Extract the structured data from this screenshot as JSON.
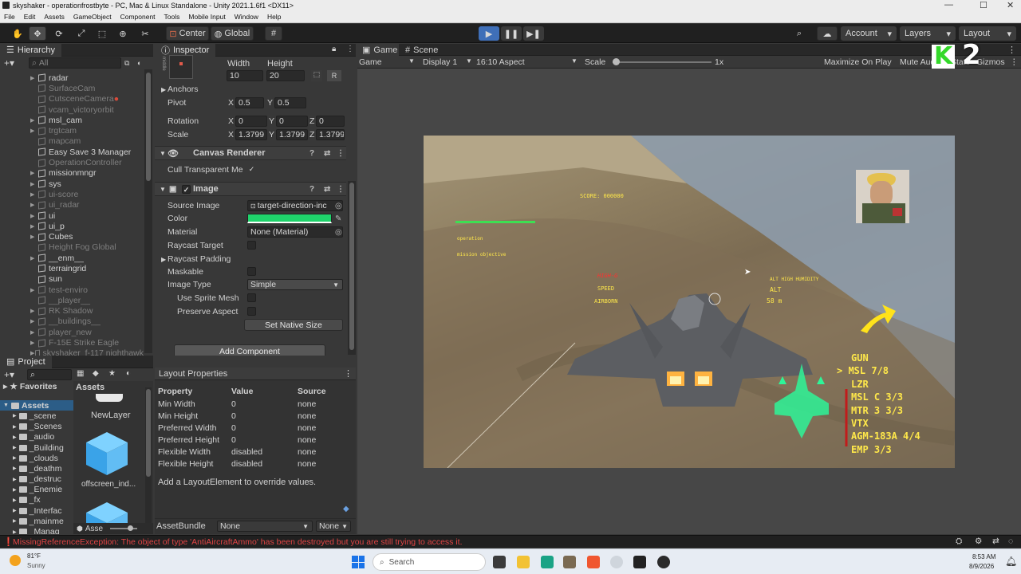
{
  "window": {
    "title": "skyshaker - operationfrostbyte - PC, Mac & Linux Standalone - Unity 2021.1.6f1 <DX11>",
    "minimize": "—",
    "maximize": "☐",
    "close": "✕"
  },
  "menu": [
    "File",
    "Edit",
    "Assets",
    "GameObject",
    "Component",
    "Tools",
    "Mobile Input",
    "Window",
    "Help"
  ],
  "toolbar": {
    "pivot": "Center",
    "space": "Global",
    "account": "Account",
    "layers": "Layers",
    "layout": "Layout"
  },
  "hierarchy": {
    "title": "Hierarchy",
    "search_placeholder": "All",
    "items": [
      {
        "label": "radar",
        "dim": false,
        "arrow": true
      },
      {
        "label": "SurfaceCam",
        "dim": true,
        "arrow": false
      },
      {
        "label": "CutsceneCamera",
        "dim": true,
        "arrow": false
      },
      {
        "label": "vcam_victoryorbit",
        "dim": true,
        "arrow": false
      },
      {
        "label": "msl_cam",
        "dim": false,
        "arrow": true
      },
      {
        "label": "trgtcam",
        "dim": true,
        "arrow": true
      },
      {
        "label": "mapcam",
        "dim": true,
        "arrow": false
      },
      {
        "label": "Easy Save 3 Manager",
        "dim": false,
        "arrow": false
      },
      {
        "label": "OperationController",
        "dim": true,
        "arrow": false
      },
      {
        "label": "missionmngr",
        "dim": false,
        "arrow": true
      },
      {
        "label": "sys",
        "dim": false,
        "arrow": true
      },
      {
        "label": "ui-score",
        "dim": true,
        "arrow": true
      },
      {
        "label": "ui_radar",
        "dim": true,
        "arrow": true
      },
      {
        "label": "ui",
        "dim": false,
        "arrow": true
      },
      {
        "label": "ui_p",
        "dim": false,
        "arrow": true
      },
      {
        "label": "Cubes",
        "dim": false,
        "arrow": true
      },
      {
        "label": "Height Fog Global",
        "dim": true,
        "arrow": false
      },
      {
        "label": "__enm__",
        "dim": false,
        "arrow": true
      },
      {
        "label": "terraingrid",
        "dim": false,
        "arrow": false
      },
      {
        "label": "sun",
        "dim": false,
        "arrow": false
      },
      {
        "label": "test-enviro",
        "dim": true,
        "arrow": true
      },
      {
        "label": "__player__",
        "dim": true,
        "arrow": false
      },
      {
        "label": "RK Shadow",
        "dim": true,
        "arrow": true
      },
      {
        "label": "__buildings__",
        "dim": true,
        "arrow": true
      },
      {
        "label": "player_new",
        "dim": true,
        "arrow": true
      },
      {
        "label": "F-15E Strike Eagle",
        "dim": true,
        "arrow": true
      },
      {
        "label": "skyshaker_f-117 nighthawk",
        "dim": true,
        "arrow": true
      }
    ]
  },
  "inspector": {
    "title": "Inspector",
    "middle_label": "middle",
    "width_label": "Width",
    "height_label": "Height",
    "width": "10",
    "height": "20",
    "r_button": "R",
    "anchors": "Anchors",
    "pivot_label": "Pivot",
    "pivot_x": "0.5",
    "pivot_y": "0.5",
    "rotation_label": "Rotation",
    "rot_x": "0",
    "rot_y": "0",
    "rot_z": "0",
    "scale_label": "Scale",
    "scale_x": "1.3799",
    "scale_y": "1.3799",
    "scale_z": "1.3799",
    "x": "X",
    "y": "Y",
    "z": "Z",
    "canvas_renderer": "Canvas Renderer",
    "cull_label": "Cull Transparent Me",
    "image_component": "Image",
    "source_image_label": "Source Image",
    "source_image": "target-direction-inc",
    "color_label": "Color",
    "color_value": "#1fd36b",
    "material_label": "Material",
    "material": "None (Material)",
    "raycast_target": "Raycast Target",
    "raycast_padding": "Raycast Padding",
    "maskable": "Maskable",
    "image_type_label": "Image Type",
    "image_type": "Simple",
    "use_sprite_mesh": "Use Sprite Mesh",
    "preserve_aspect": "Preserve Aspect",
    "set_native_size": "Set Native Size",
    "add_component": "Add Component",
    "check": "✓"
  },
  "layout_props": {
    "title": "Layout Properties",
    "headers": [
      "Property",
      "Value",
      "Source"
    ],
    "rows": [
      [
        "Min Width",
        "0",
        "none"
      ],
      [
        "Min Height",
        "0",
        "none"
      ],
      [
        "Preferred Width",
        "0",
        "none"
      ],
      [
        "Preferred Height",
        "0",
        "none"
      ],
      [
        "Flexible Width",
        "disabled",
        "none"
      ],
      [
        "Flexible Height",
        "disabled",
        "none"
      ]
    ],
    "hint": "Add a LayoutElement to override values."
  },
  "asset_bundle": {
    "label": "AssetBundle",
    "value": "None",
    "variant": "None"
  },
  "project": {
    "title": "Project",
    "favorites": "Favorites",
    "assets_root": "Assets",
    "assets_header": "Assets",
    "folders": [
      "_scene",
      "_Scenes",
      "_audio",
      "_Building",
      "_clouds",
      "_deathm",
      "_destruc",
      "_Enemie",
      "_fx",
      "_Interfac",
      "_mainme",
      "_Manag"
    ],
    "files": [
      {
        "label": "NewLayer"
      },
      {
        "label": "offscreen_ind..."
      },
      {
        "label": ""
      }
    ],
    "footer": "Asse"
  },
  "game": {
    "tab_game": "Game",
    "tab_scene": "Scene",
    "display_dropdown": "Game",
    "display": "Display 1",
    "aspect": "16:10 Aspect",
    "scale_label": "Scale",
    "scale_value": "1x",
    "maximize": "Maximize On Play",
    "mute": "Mute Audio",
    "stats": "Stats",
    "gizmos": "Gizmos",
    "hud": {
      "score": "SCORE: 000000",
      "tag1": "HIGH-G",
      "speed": "SPEED",
      "tag2": "AIRBORN",
      "alt_note": "ALT  HIGH HUMIDITY",
      "alt": "ALT",
      "alt_value": "58 m",
      "weapons": [
        "GUN",
        "> MSL 7/8",
        "LZR",
        "MSL C 3/3",
        "MTR 3 3/3",
        "VTX",
        "AGM-183A 4/4",
        "EMP 3/3"
      ],
      "mission1": "operation",
      "mission2": "mission objective"
    }
  },
  "overlay": {
    "k": "K",
    "two": "2"
  },
  "status": {
    "error": "MissingReferenceException: The object of type 'AntiAircraftAmmo' has been destroyed but you are still trying to access it."
  },
  "taskbar": {
    "temp": "81°F",
    "weather": "Sunny",
    "search": "Search",
    "time": "8:53 AM",
    "date": "8/9/2026"
  }
}
